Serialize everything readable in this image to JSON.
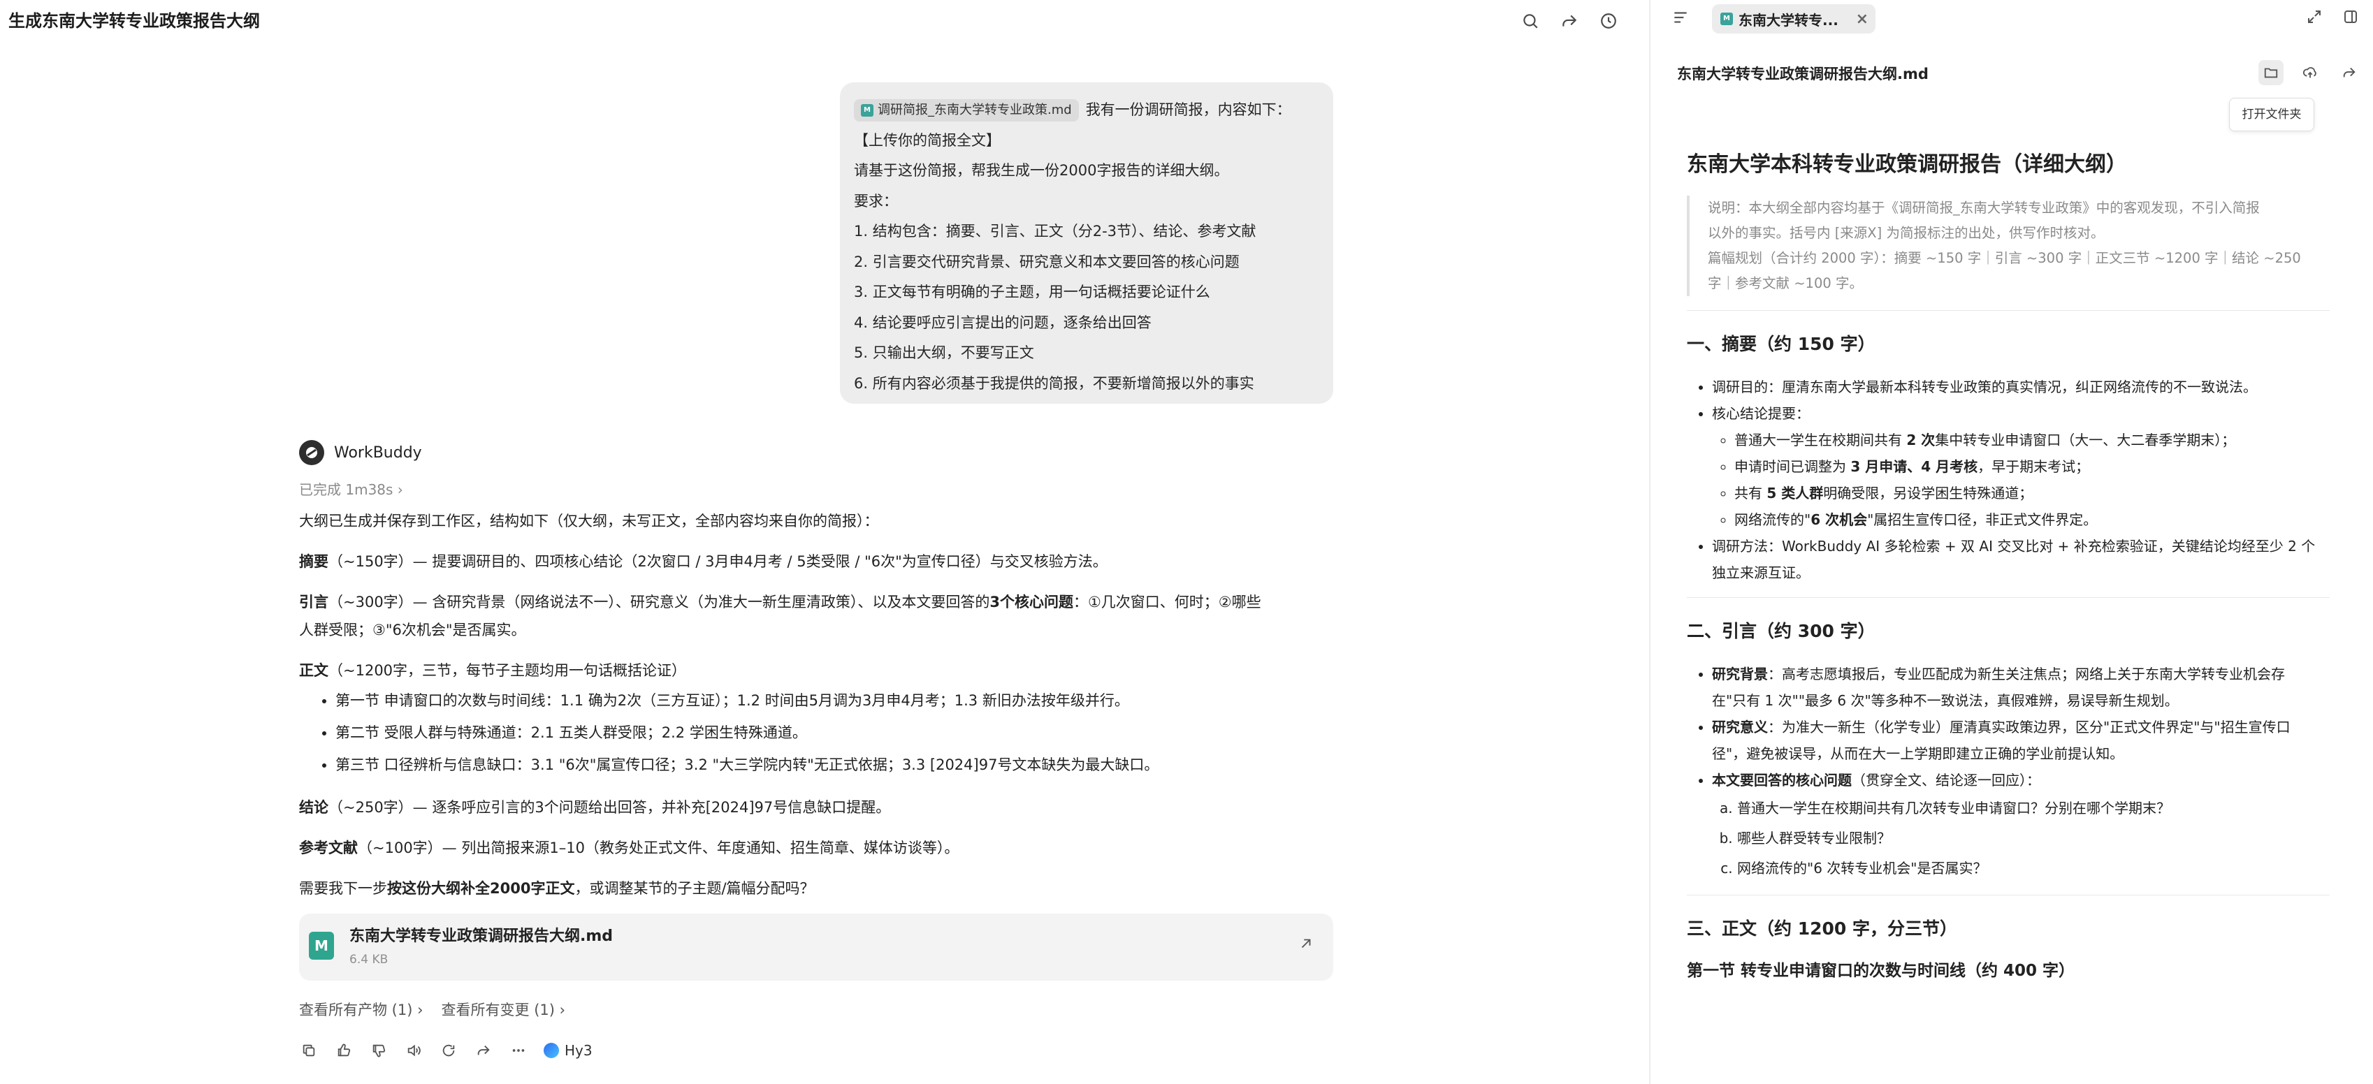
{
  "header": {
    "title": "生成东南大学转专业政策报告大纲"
  },
  "user_message": {
    "attachment": "调研简报_东南大学转专业政策.md",
    "first_line": "我有一份调研简报，内容如下：",
    "lines": [
      "【上传你的简报全文】",
      "请基于这份简报，帮我生成一份2000字报告的详细大纲。",
      "要求：",
      "1. 结构包含：摘要、引言、正文（分2-3节）、结论、参考文献",
      "2. 引言要交代研究背景、研究意义和本文要回答的核心问题",
      "3. 正文每节有明确的子主题，用一句话概括要论证什么",
      "4. 结论要呼应引言提出的问题，逐条给出回答",
      "5. 只输出大纲，不要写正文",
      "6. 所有内容必须基于我提供的简报，不要新增简报以外的事实"
    ]
  },
  "assistant": {
    "name": "WorkBuddy",
    "status": "已完成 1m38s",
    "intro": "大纲已生成并保存到工作区，结构如下（仅大纲，未写正文，全部内容均来自你的简报）：",
    "abstract_label": "摘要",
    "abstract_text": "（~150字）— 提要调研目的、四项核心结论（2次窗口 / 3月申4月考 / 5类受限 / \"6次\"为宣传口径）与交叉核验方法。",
    "intro_label": "引言",
    "intro_text_a": "（~300字）— 含研究背景（网络说法不一）、研究意义（为准大一新生厘清政策）、以及本文要回答的",
    "intro_bold": "3个核心问题",
    "intro_text_b": "：①几次窗口、何时；②哪些",
    "intro_text_c": "人群受限；③\"6次机会\"是否属实。",
    "body_label": "正文",
    "body_text": "（~1200字，三节，每节子主题均用一句话概括论证）",
    "body_items": [
      "第一节 申请窗口的次数与时间线：1.1 确为2次（三方互证）；1.2 时间由5月调为3月申4月考；1.3 新旧办法按年级并行。",
      "第二节 受限人群与特殊通道：2.1 五类人群受限；2.2 学困生特殊通道。",
      "第三节 口径辨析与信息缺口：3.1 \"6次\"属宣传口径；3.2 \"大三学院内转\"无正式依据；3.3 [2024]97号文本缺失为最大缺口。"
    ],
    "conclusion_label": "结论",
    "conclusion_text": "（~250字）— 逐条呼应引言的3个问题给出回答，并补充[2024]97号信息缺口提醒。",
    "refs_label": "参考文献",
    "refs_text": "（~100字）— 列出简报来源1–10（教务处正式文件、年度通知、招生简章、媒体访谈等）。",
    "question_a": "需要我下一步",
    "question_bold": "按这份大纲补全2000字正文",
    "question_b": "，或调整某节的子主题/篇幅分配吗？",
    "file_name": "东南大学转专业政策调研报告大纲.md",
    "file_size": "6.4 KB",
    "link_products": "查看所有产物 (1)",
    "link_changes": "查看所有变更 (1)",
    "model": "Hy3"
  },
  "panel": {
    "tab_label": "东南大学转专...",
    "doc_title": "东南大学转专业政策调研报告大纲.md",
    "tooltip": "打开文件夹",
    "h1": "东南大学本科转专业政策调研报告（详细大纲）",
    "note_1": "说明：本大纲全部内容均基于《调研简报_东南大学转专业政策》中的客观发现，不引入简报",
    "note_2": "以外的事实。括号内 [来源X] 为简报标注的出处，供写作时核对。",
    "note_3": "篇幅规划（合计约 2000 字）：摘要 ~150 字｜引言 ~300 字｜正文三节 ~1200 字｜结论 ~250",
    "note_4": "字｜参考文献 ~100 字。",
    "s1_title": "一、摘要（约 150 字）",
    "s1_item1": "调研目的：厘清东南大学最新本科转专业政策的真实情况，纠正网络流传的不一致说法。",
    "s1_item2": "核心结论提要：",
    "s1_sub1_a": "普通大一学生在校期间共有 ",
    "s1_sub1_b": "2 次",
    "s1_sub1_c": "集中转专业申请窗口（大一、大二春季学期末）；",
    "s1_sub2_a": "申请时间已调整为 ",
    "s1_sub2_b": "3 月申请、4 月考核",
    "s1_sub2_c": "，早于期末考试；",
    "s1_sub3_a": "共有 ",
    "s1_sub3_b": "5 类人群",
    "s1_sub3_c": "明确受限，另设学困生特殊通道；",
    "s1_sub4_a": "网络流传的\"",
    "s1_sub4_b": "6 次机会",
    "s1_sub4_c": "\"属招生宣传口径，非正式文件界定。",
    "s1_item3_a": "调研方法：WorkBuddy AI 多轮检索 + 双 AI 交叉比对 + 补充检索验证，关键结论均经至少 2 个",
    "s1_item3_b": "独立来源互证。",
    "s2_title": "二、引言（约 300 字）",
    "s2_item1_label": "研究背景",
    "s2_item1_a": "：高考志愿填报后，专业匹配成为新生关注焦点；网络上关于东南大学转专业机会存",
    "s2_item1_b": "在\"只有 1 次\"\"最多 6 次\"等多种不一致说法，真假难辨，易误导新生规划。",
    "s2_item2_label": "研究意义",
    "s2_item2_a": "：为准大一新生（化学专业）厘清真实政策边界，区分\"正式文件界定\"与\"招生宣传口",
    "s2_item2_b": "径\"，避免被误导，从而在大一上学期即建立正确的学业前提认知。",
    "s2_item3_label": "本文要回答的核心问题",
    "s2_item3_text": "（贯穿全文、结论逐一回应）：",
    "s2_q": [
      "普通大一学生在校期间共有几次转专业申请窗口？分别在哪个学期末？",
      "哪些人群受转专业限制？",
      "网络流传的\"6 次转专业机会\"是否属实？"
    ],
    "s3_title": "三、正文（约 1200 字，分三节）",
    "s3_sub_title": "第一节 转专业申请窗口的次数与时间线（约 400 字）"
  }
}
